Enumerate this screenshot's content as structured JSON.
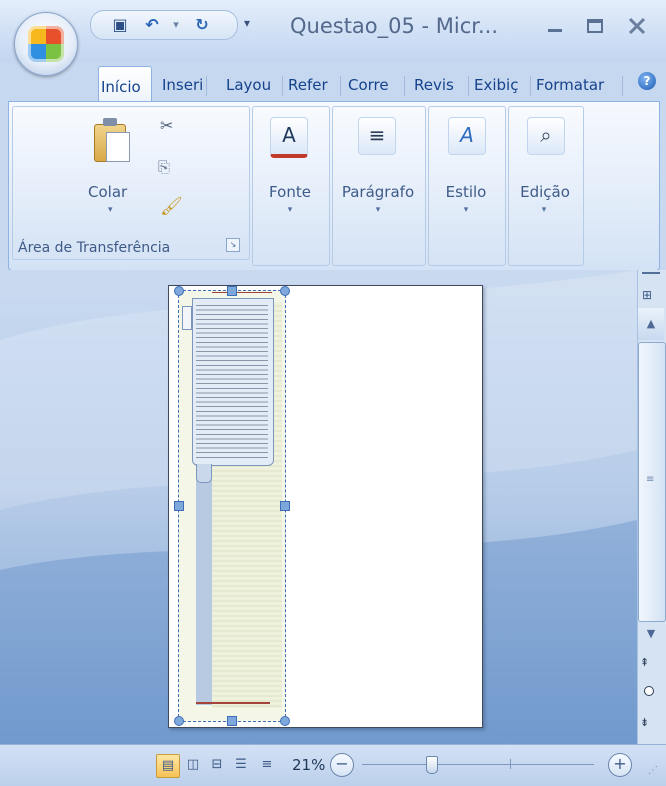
{
  "window": {
    "title": "Questao_05 - Micr...",
    "minimize_icon": "minimize-icon",
    "maximize_icon": "maximize-icon",
    "close_icon": "close-icon"
  },
  "quick_access": {
    "save_icon": "save-icon",
    "undo_icon": "undo-icon",
    "redo_icon": "redo-icon",
    "customize_icon": "customize-dropdown-icon",
    "save_glyph": "▣",
    "undo_glyph": "↶",
    "undo_dd_glyph": "▾",
    "redo_glyph": "↻",
    "customize_glyph": "▾"
  },
  "tabs": [
    {
      "label": "Início",
      "active": true
    },
    {
      "label": "Inseri"
    },
    {
      "label": "Layou"
    },
    {
      "label": "Refer"
    },
    {
      "label": "Corre"
    },
    {
      "label": "Revis"
    },
    {
      "label": "Exibiç"
    },
    {
      "label": "Formatar"
    }
  ],
  "ribbon": {
    "clipboard": {
      "paste_label": "Colar",
      "group_label": "Área de Transferência",
      "cut_glyph": "✂",
      "copy_glyph": "⎘",
      "format_glyph": "🖌",
      "launcher_glyph": "↘"
    },
    "groups": [
      {
        "label": "Fonte",
        "icon": "font-color-icon",
        "glyph": "A",
        "color": "#c0392b"
      },
      {
        "label": "Parágrafo",
        "icon": "align-icon",
        "glyph": "≡",
        "color": "#2a3b55"
      },
      {
        "label": "Estilo",
        "icon": "style-icon",
        "glyph": "A",
        "color": "#2f6cc0"
      },
      {
        "label": "Edição",
        "icon": "find-icon",
        "glyph": "⌕",
        "color": "#3b4c66"
      }
    ],
    "dropdown_glyph": "▾"
  },
  "status": {
    "zoom": "21%",
    "zoom_out": "−",
    "zoom_in": "+",
    "zoom_level_percent": 21,
    "view_glyphs": [
      "▤",
      "◫",
      "⊟",
      "☰",
      "≡"
    ]
  },
  "scrollbar": {
    "up_glyph": "▲",
    "down_glyph": "▼",
    "prev_glyph": "⇞",
    "next_glyph": "⇟",
    "grip_glyph": "≡",
    "ruler_glyph": "⊞"
  },
  "colors": {
    "accent": "#15428b",
    "frame": "#3e6fb6",
    "red_rule": "#a4433a"
  }
}
